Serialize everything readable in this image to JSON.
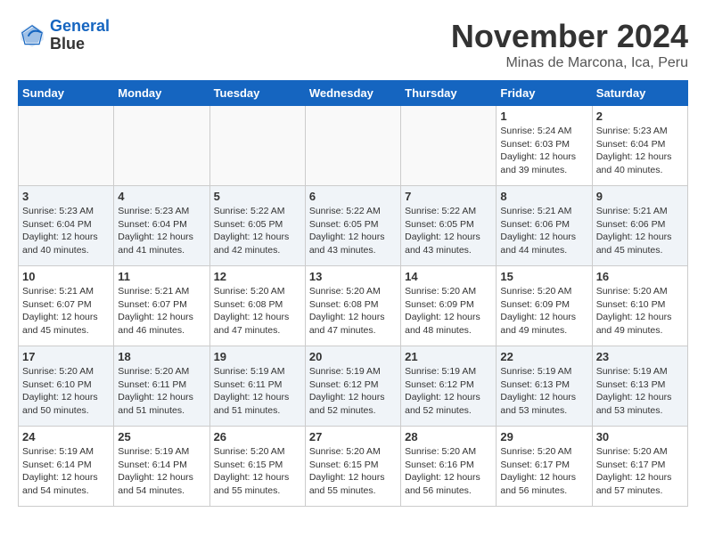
{
  "header": {
    "logo_line1": "General",
    "logo_line2": "Blue",
    "month_title": "November 2024",
    "subtitle": "Minas de Marcona, Ica, Peru"
  },
  "weekdays": [
    "Sunday",
    "Monday",
    "Tuesday",
    "Wednesday",
    "Thursday",
    "Friday",
    "Saturday"
  ],
  "weeks": [
    [
      {
        "day": "",
        "info": ""
      },
      {
        "day": "",
        "info": ""
      },
      {
        "day": "",
        "info": ""
      },
      {
        "day": "",
        "info": ""
      },
      {
        "day": "",
        "info": ""
      },
      {
        "day": "1",
        "info": "Sunrise: 5:24 AM\nSunset: 6:03 PM\nDaylight: 12 hours and 39 minutes."
      },
      {
        "day": "2",
        "info": "Sunrise: 5:23 AM\nSunset: 6:04 PM\nDaylight: 12 hours and 40 minutes."
      }
    ],
    [
      {
        "day": "3",
        "info": "Sunrise: 5:23 AM\nSunset: 6:04 PM\nDaylight: 12 hours and 40 minutes."
      },
      {
        "day": "4",
        "info": "Sunrise: 5:23 AM\nSunset: 6:04 PM\nDaylight: 12 hours and 41 minutes."
      },
      {
        "day": "5",
        "info": "Sunrise: 5:22 AM\nSunset: 6:05 PM\nDaylight: 12 hours and 42 minutes."
      },
      {
        "day": "6",
        "info": "Sunrise: 5:22 AM\nSunset: 6:05 PM\nDaylight: 12 hours and 43 minutes."
      },
      {
        "day": "7",
        "info": "Sunrise: 5:22 AM\nSunset: 6:05 PM\nDaylight: 12 hours and 43 minutes."
      },
      {
        "day": "8",
        "info": "Sunrise: 5:21 AM\nSunset: 6:06 PM\nDaylight: 12 hours and 44 minutes."
      },
      {
        "day": "9",
        "info": "Sunrise: 5:21 AM\nSunset: 6:06 PM\nDaylight: 12 hours and 45 minutes."
      }
    ],
    [
      {
        "day": "10",
        "info": "Sunrise: 5:21 AM\nSunset: 6:07 PM\nDaylight: 12 hours and 45 minutes."
      },
      {
        "day": "11",
        "info": "Sunrise: 5:21 AM\nSunset: 6:07 PM\nDaylight: 12 hours and 46 minutes."
      },
      {
        "day": "12",
        "info": "Sunrise: 5:20 AM\nSunset: 6:08 PM\nDaylight: 12 hours and 47 minutes."
      },
      {
        "day": "13",
        "info": "Sunrise: 5:20 AM\nSunset: 6:08 PM\nDaylight: 12 hours and 47 minutes."
      },
      {
        "day": "14",
        "info": "Sunrise: 5:20 AM\nSunset: 6:09 PM\nDaylight: 12 hours and 48 minutes."
      },
      {
        "day": "15",
        "info": "Sunrise: 5:20 AM\nSunset: 6:09 PM\nDaylight: 12 hours and 49 minutes."
      },
      {
        "day": "16",
        "info": "Sunrise: 5:20 AM\nSunset: 6:10 PM\nDaylight: 12 hours and 49 minutes."
      }
    ],
    [
      {
        "day": "17",
        "info": "Sunrise: 5:20 AM\nSunset: 6:10 PM\nDaylight: 12 hours and 50 minutes."
      },
      {
        "day": "18",
        "info": "Sunrise: 5:20 AM\nSunset: 6:11 PM\nDaylight: 12 hours and 51 minutes."
      },
      {
        "day": "19",
        "info": "Sunrise: 5:19 AM\nSunset: 6:11 PM\nDaylight: 12 hours and 51 minutes."
      },
      {
        "day": "20",
        "info": "Sunrise: 5:19 AM\nSunset: 6:12 PM\nDaylight: 12 hours and 52 minutes."
      },
      {
        "day": "21",
        "info": "Sunrise: 5:19 AM\nSunset: 6:12 PM\nDaylight: 12 hours and 52 minutes."
      },
      {
        "day": "22",
        "info": "Sunrise: 5:19 AM\nSunset: 6:13 PM\nDaylight: 12 hours and 53 minutes."
      },
      {
        "day": "23",
        "info": "Sunrise: 5:19 AM\nSunset: 6:13 PM\nDaylight: 12 hours and 53 minutes."
      }
    ],
    [
      {
        "day": "24",
        "info": "Sunrise: 5:19 AM\nSunset: 6:14 PM\nDaylight: 12 hours and 54 minutes."
      },
      {
        "day": "25",
        "info": "Sunrise: 5:19 AM\nSunset: 6:14 PM\nDaylight: 12 hours and 54 minutes."
      },
      {
        "day": "26",
        "info": "Sunrise: 5:20 AM\nSunset: 6:15 PM\nDaylight: 12 hours and 55 minutes."
      },
      {
        "day": "27",
        "info": "Sunrise: 5:20 AM\nSunset: 6:15 PM\nDaylight: 12 hours and 55 minutes."
      },
      {
        "day": "28",
        "info": "Sunrise: 5:20 AM\nSunset: 6:16 PM\nDaylight: 12 hours and 56 minutes."
      },
      {
        "day": "29",
        "info": "Sunrise: 5:20 AM\nSunset: 6:17 PM\nDaylight: 12 hours and 56 minutes."
      },
      {
        "day": "30",
        "info": "Sunrise: 5:20 AM\nSunset: 6:17 PM\nDaylight: 12 hours and 57 minutes."
      }
    ]
  ]
}
